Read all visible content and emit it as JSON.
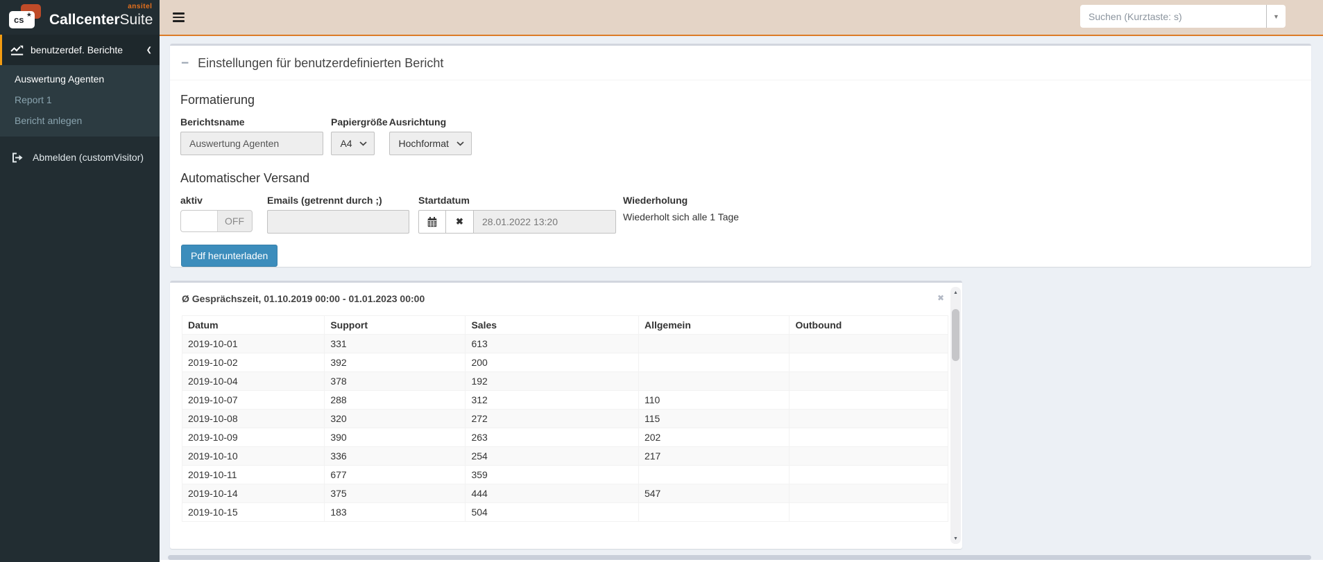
{
  "brand": {
    "app_name_bold": "Callcenter",
    "app_name_light": "Suite",
    "vendor": "ansitel",
    "icon_text": "cs",
    "icon_star": "★"
  },
  "topbar": {
    "search_placeholder": "Suchen (Kurztaste: s)",
    "search_caret_glyph": "▼"
  },
  "sidebar": {
    "section_label": "benutzerdef. Berichte",
    "section_chevron_glyph": "❮",
    "items": [
      {
        "label": "Auswertung Agenten",
        "active": true
      },
      {
        "label": "Report 1",
        "active": false
      },
      {
        "label": "Bericht anlegen",
        "active": false
      }
    ],
    "logout_label": "Abmelden (customVisitor)"
  },
  "settings_panel": {
    "collapse_glyph": "−",
    "title": "Einstellungen für benutzerdefinierten Bericht",
    "formatting": {
      "heading": "Formatierung",
      "report_name_label": "Berichtsname",
      "report_name_value": "Auswertung Agenten",
      "paper_size_label": "Papiergröße",
      "paper_size_value": "A4",
      "orientation_label": "Ausrichtung",
      "orientation_value": "Hochformat"
    },
    "auto_send": {
      "heading": "Automatischer Versand",
      "active_label": "aktiv",
      "active_state": "OFF",
      "emails_label": "Emails (getrennt durch ;)",
      "emails_value": "",
      "start_date_label": "Startdatum",
      "start_date_value": "28.01.2022 13:20",
      "clear_glyph": "✖",
      "repeat_label": "Wiederholung",
      "repeat_text": "Wiederholt sich alle 1 Tage"
    },
    "download_button_label": "Pdf herunterladen"
  },
  "report_panel": {
    "title": "Ø Gesprächszeit, 01.10.2019 00:00 - 01.01.2023 00:00",
    "close_glyph": "✖",
    "scroll_up_glyph": "▲",
    "scroll_down_glyph": "▼",
    "table": {
      "columns": [
        "Datum",
        "Support",
        "Sales",
        "Allgemein",
        "Outbound"
      ],
      "column_widths_pct": [
        18.6,
        18.4,
        22.6,
        19.7,
        20.7
      ],
      "rows": [
        [
          "2019-10-01",
          "331",
          "613",
          "",
          ""
        ],
        [
          "2019-10-02",
          "392",
          "200",
          "",
          ""
        ],
        [
          "2019-10-04",
          "378",
          "192",
          "",
          ""
        ],
        [
          "2019-10-07",
          "288",
          "312",
          "110",
          ""
        ],
        [
          "2019-10-08",
          "320",
          "272",
          "115",
          ""
        ],
        [
          "2019-10-09",
          "390",
          "263",
          "202",
          ""
        ],
        [
          "2019-10-10",
          "336",
          "254",
          "217",
          ""
        ],
        [
          "2019-10-11",
          "677",
          "359",
          "",
          ""
        ],
        [
          "2019-10-14",
          "375",
          "444",
          "547",
          ""
        ],
        [
          "2019-10-15",
          "183",
          "504",
          "",
          ""
        ]
      ]
    }
  },
  "colors": {
    "sidebar_dark": "#222d32",
    "submenu_dark": "#2c3b41",
    "active_border_orange": "#f39c12",
    "navbar_tan": "#e4d4c6",
    "navbar_line_orange": "#dc7b26",
    "brand_bubble_orange": "#bf4b28",
    "vendor_orange": "#e8711c",
    "button_blue": "#3c8dbc",
    "content_bg": "#ecf0f5"
  }
}
